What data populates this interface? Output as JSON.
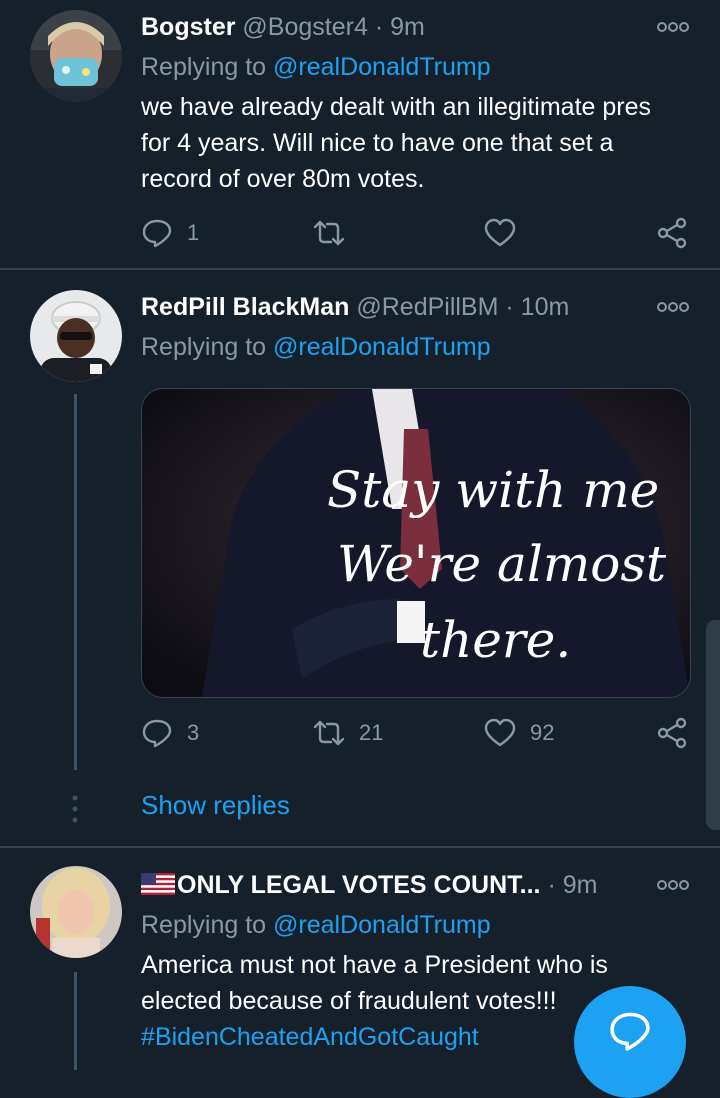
{
  "tweets": [
    {
      "name": "Bogster",
      "handle": "@Bogster4",
      "sep": "·",
      "time": "9m",
      "replying_prefix": "Replying to",
      "replying_to": "@realDonaldTrump",
      "text": "we have already dealt with an illegitimate pres for 4 years. Will nice to have one that set a record of over 80m votes.",
      "replies": "1",
      "retweets": "",
      "likes": ""
    },
    {
      "name": "RedPill BlackMan",
      "handle": "@RedPillBM",
      "sep": "·",
      "time": "10m",
      "replying_prefix": "Replying to",
      "replying_to": "@realDonaldTrump",
      "media_text_line1": "Stay with me",
      "media_text_line2": "We're almost",
      "media_text_line3": "there.",
      "replies": "3",
      "retweets": "21",
      "likes": "92",
      "show_replies": "Show replies"
    },
    {
      "name": "ONLY LEGAL VOTES COUNT...",
      "sep": "·",
      "time": "9m",
      "replying_prefix": "Replying to",
      "replying_to": "@realDonaldTrump",
      "text": "America must not have a President who is elected because of fraudulent votes!!!",
      "hashtag": "#BidenCheatedAndGotCaught"
    }
  ],
  "colors": {
    "background": "#15202b",
    "accent": "#1da1f2",
    "muted": "#8899a6",
    "separator": "#38444d"
  },
  "icons": [
    "more-icon",
    "reply-icon",
    "retweet-icon",
    "like-icon",
    "share-icon",
    "compose-icon",
    "us-flag-icon"
  ]
}
